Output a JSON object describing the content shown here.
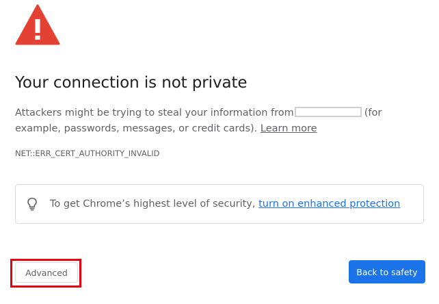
{
  "header": {
    "icon": "warning-triangle-icon",
    "icon_color": "#e34133"
  },
  "main": {
    "title": "Your connection is not private",
    "description_before": "Attackers might be trying to steal your information from",
    "description_after": "(for example, passwords, messages, or credit cards).",
    "learn_more_label": "Learn more",
    "error_code": "NET::ERR_CERT_AUTHORITY_INVALID"
  },
  "security_box": {
    "icon": "lightbulb-icon",
    "text": "To get Chrome’s highest level of security,",
    "link_label": "turn on enhanced protection",
    "link_color": "#1a73e8"
  },
  "actions": {
    "advanced_label": "Advanced",
    "back_to_safety_label": "Back to safety",
    "primary_color": "#1a73e8",
    "highlight_color": "#e60012"
  }
}
